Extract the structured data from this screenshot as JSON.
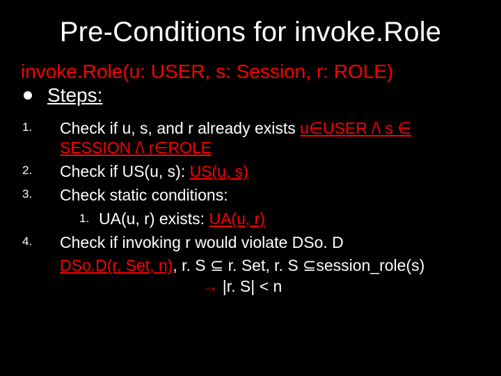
{
  "title": "Pre-Conditions for invoke.Role",
  "invoke_signature": "invoke.Role(u: USER, s: Session, r: ROLE)",
  "steps_label": "Steps:",
  "step1": {
    "prefix": "Check if u, s, and r already exists ",
    "cond": "u∈USER /\\ s ∈ SESSION /\\ r∈ROLE"
  },
  "step2": {
    "prefix": "Check if US(u, s): ",
    "cond": "US(u, s)"
  },
  "step3": {
    "text": "Check static conditions:",
    "sub_num": "1.",
    "sub_prefix": "UA(u, r) exists: ",
    "sub_cond": "UA(u, r)"
  },
  "step4": {
    "text": "Check if invoking r would violate DSo. D",
    "line2_a": "DSo.D(r. Set, n)",
    "line2_b": ", r. S ⊆ r. Set, r. S ⊆session_role(s)",
    "arrow": "→",
    "line3": "|r. S| < n"
  }
}
